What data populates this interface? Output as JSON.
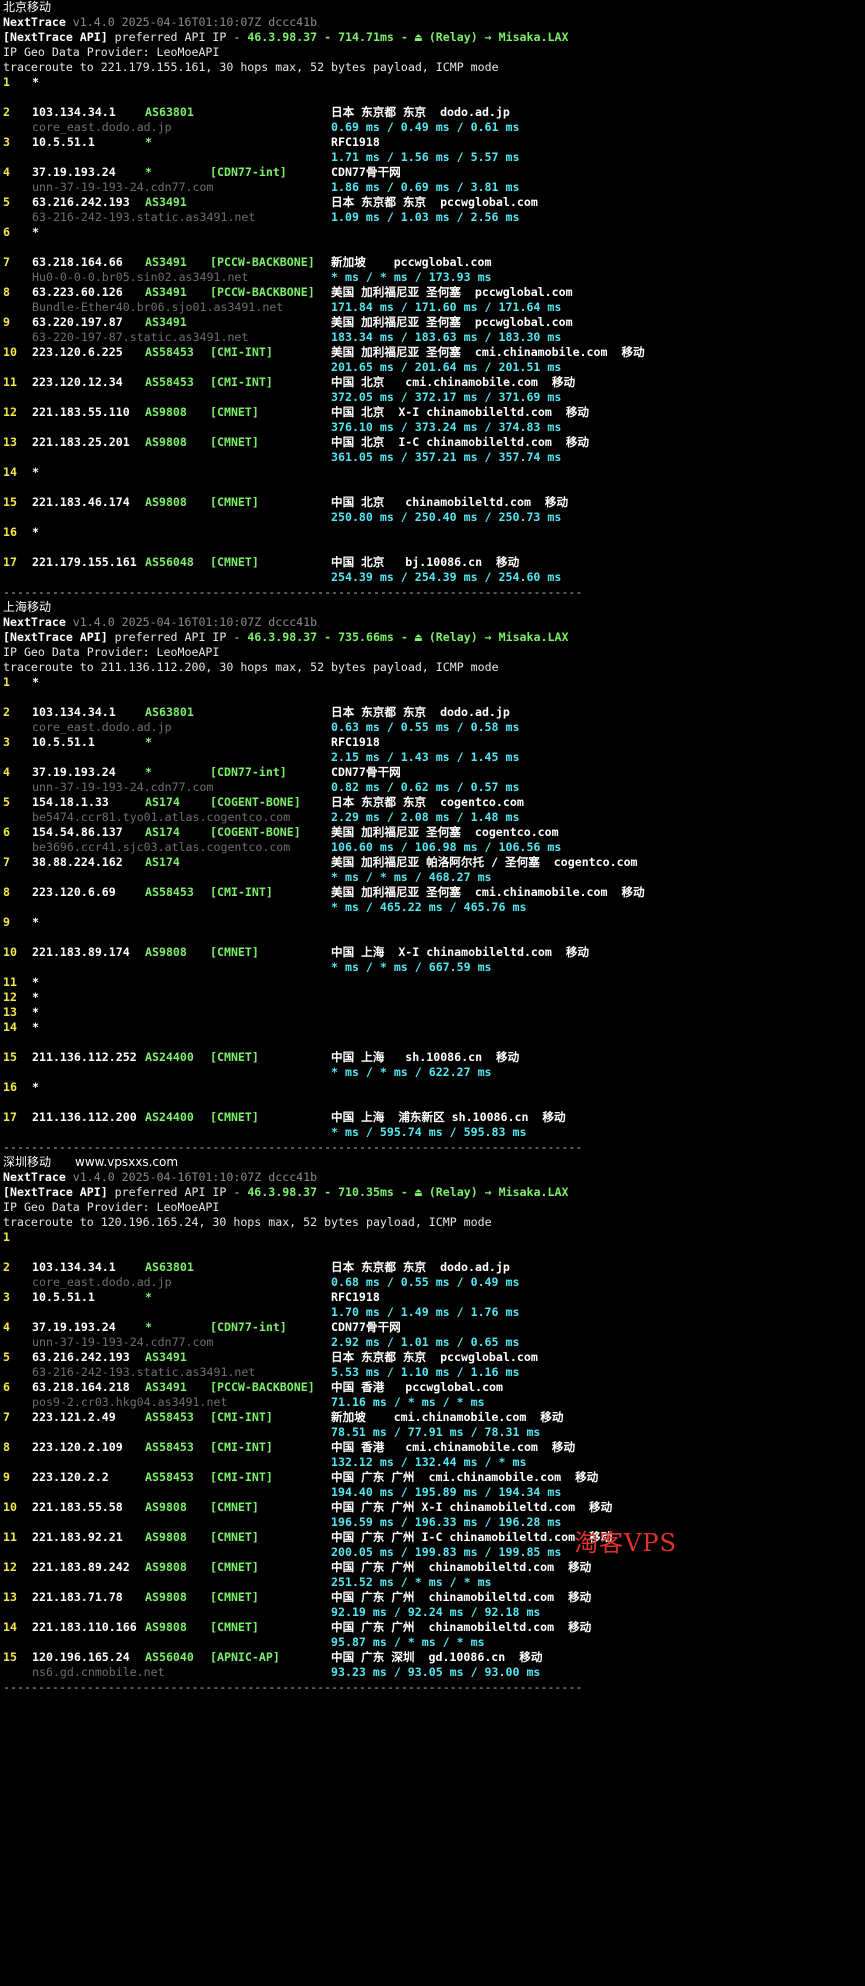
{
  "version_line": "v1.4.0 2025-04-16T01:10:07Z dccc41b",
  "watermark": "淘客VPS",
  "sections": [
    {
      "header": "北京移动",
      "api_label": "[NextTrace API]",
      "api_text": " preferred API IP - ",
      "api_ip": "46.3.98.37",
      "api_rest": " - 714.71ms - ",
      "api_relay": "⏏ (Relay) → Misaka.LAX",
      "geo_provider": "IP Geo Data Provider: LeoMoeAPI",
      "trace_cmd": "traceroute to 221.179.155.161, 30 hops max, 52 bytes payload, ICMP mode",
      "hops": [
        {
          "n": "1",
          "star": true
        },
        {
          "n": "2",
          "ip": "103.134.34.1",
          "asn": "AS63801",
          "tag": "",
          "geo": "日本 东京都 东京  dodo.ad.jp",
          "rdns": "core_east.dodo.ad.jp",
          "rtt": "0.69 ms / 0.49 ms / 0.61 ms"
        },
        {
          "n": "3",
          "ip": "10.5.51.1",
          "asn": "*",
          "tag": "",
          "geo": "RFC1918",
          "rdns": "",
          "rtt": "1.71 ms / 1.56 ms / 5.57 ms"
        },
        {
          "n": "4",
          "ip": "37.19.193.24",
          "asn": "*",
          "tag": "[CDN77-int]",
          "geo": "CDN77骨干网",
          "rdns": "unn-37-19-193-24.cdn77.com",
          "rtt": "1.86 ms / 0.69 ms / 3.81 ms"
        },
        {
          "n": "5",
          "ip": "63.216.242.193",
          "asn": "AS3491",
          "tag": "",
          "geo": "日本 东京都 东京  pccwglobal.com",
          "rdns": "63-216-242-193.static.as3491.net",
          "rtt": "1.09 ms / 1.03 ms / 2.56 ms",
          "rtt_same": true
        },
        {
          "n": "6",
          "star": true
        },
        {
          "n": "7",
          "ip": "63.218.164.66",
          "asn": "AS3491",
          "tag": "[PCCW-BACKBONE]",
          "geo": "新加坡    pccwglobal.com",
          "rdns": "Hu0-0-0-0.br05.sin02.as3491.net",
          "rtt": "* ms / * ms / 173.93 ms"
        },
        {
          "n": "8",
          "ip": "63.223.60.126",
          "asn": "AS3491",
          "tag": "[PCCW-BACKBONE]",
          "geo": "美国 加利福尼亚 圣何塞  pccwglobal.com",
          "rdns": "Bundle-Ether40.br06.sjo01.as3491.net",
          "rtt": "171.84 ms / 171.60 ms / 171.64 ms"
        },
        {
          "n": "9",
          "ip": "63.220.197.87",
          "asn": "AS3491",
          "tag": "",
          "geo": "美国 加利福尼亚 圣何塞  pccwglobal.com",
          "rdns": "63-220-197-87.static.as3491.net",
          "rtt": "183.34 ms / 183.63 ms / 183.30 ms"
        },
        {
          "n": "10",
          "ip": "223.120.6.225",
          "asn": "AS58453",
          "tag": "[CMI-INT]",
          "geo": "美国 加利福尼亚 圣何塞  cmi.chinamobile.com  移动",
          "rdns": "",
          "rtt": "201.65 ms / 201.64 ms / 201.51 ms"
        },
        {
          "n": "11",
          "ip": "223.120.12.34",
          "asn": "AS58453",
          "tag": "[CMI-INT]",
          "geo": "中国 北京   cmi.chinamobile.com  移动",
          "rdns": "",
          "rtt": "372.05 ms / 372.17 ms / 371.69 ms"
        },
        {
          "n": "12",
          "ip": "221.183.55.110",
          "asn": "AS9808",
          "tag": "[CMNET]",
          "geo": "中国 北京  X-I chinamobileltd.com  移动",
          "rdns": "",
          "rtt": "376.10 ms / 373.24 ms / 374.83 ms"
        },
        {
          "n": "13",
          "ip": "221.183.25.201",
          "asn": "AS9808",
          "tag": "[CMNET]",
          "geo": "中国 北京  I-C chinamobileltd.com  移动",
          "rdns": "",
          "rtt": "361.05 ms / 357.21 ms / 357.74 ms"
        },
        {
          "n": "14",
          "star": true
        },
        {
          "n": "15",
          "ip": "221.183.46.174",
          "asn": "AS9808",
          "tag": "[CMNET]",
          "geo": "中国 北京   chinamobileltd.com  移动",
          "rdns": "",
          "rtt": "250.80 ms / 250.40 ms / 250.73 ms"
        },
        {
          "n": "16",
          "star": true
        },
        {
          "n": "17",
          "ip": "221.179.155.161",
          "asn": "AS56048",
          "tag": "[CMNET]",
          "geo": "中国 北京   bj.10086.cn  移动",
          "rdns": "",
          "rtt": "254.39 ms / 254.39 ms / 254.60 ms"
        }
      ]
    },
    {
      "header": "上海移动",
      "api_label": "[NextTrace API]",
      "api_text": " preferred API IP - ",
      "api_ip": "46.3.98.37",
      "api_rest": " - 735.66ms - ",
      "api_relay": "⏏ (Relay) → Misaka.LAX",
      "geo_provider": "IP Geo Data Provider: LeoMoeAPI",
      "trace_cmd": "traceroute to 211.136.112.200, 30 hops max, 52 bytes payload, ICMP mode",
      "hops": [
        {
          "n": "1",
          "star": true
        },
        {
          "n": "2",
          "ip": "103.134.34.1",
          "asn": "AS63801",
          "tag": "",
          "geo": "日本 东京都 东京  dodo.ad.jp",
          "rdns": "core_east.dodo.ad.jp",
          "rtt": "0.63 ms / 0.55 ms / 0.58 ms"
        },
        {
          "n": "3",
          "ip": "10.5.51.1",
          "asn": "*",
          "tag": "",
          "geo": "RFC1918",
          "rdns": "",
          "rtt": "2.15 ms / 1.43 ms / 1.45 ms"
        },
        {
          "n": "4",
          "ip": "37.19.193.24",
          "asn": "*",
          "tag": "[CDN77-int]",
          "geo": "CDN77骨干网",
          "rdns": "unn-37-19-193-24.cdn77.com",
          "rtt": "0.82 ms / 0.62 ms / 0.57 ms"
        },
        {
          "n": "5",
          "ip": "154.18.1.33",
          "asn": "AS174",
          "tag": "[COGENT-BONE]",
          "geo": "日本 东京都 东京  cogentco.com",
          "rdns": "be5474.ccr81.tyo01.atlas.cogentco.com",
          "rtt": "2.29 ms / 2.08 ms / 1.48 ms"
        },
        {
          "n": "6",
          "ip": "154.54.86.137",
          "asn": "AS174",
          "tag": "[COGENT-BONE]",
          "geo": "美国 加利福尼亚 圣何塞  cogentco.com",
          "rdns": "be3696.ccr41.sjc03.atlas.cogentco.com",
          "rtt": "106.60 ms / 106.98 ms / 106.56 ms"
        },
        {
          "n": "7",
          "ip": "38.88.224.162",
          "asn": "AS174",
          "tag": "",
          "geo": "美国 加利福尼亚 帕洛阿尔托 / 圣何塞  cogentco.com",
          "rdns": "",
          "rtt": "* ms / * ms / 468.27 ms"
        },
        {
          "n": "8",
          "ip": "223.120.6.69",
          "asn": "AS58453",
          "tag": "[CMI-INT]",
          "geo": "美国 加利福尼亚 圣何塞  cmi.chinamobile.com  移动",
          "rdns": "",
          "rtt": "* ms / 465.22 ms / 465.76 ms"
        },
        {
          "n": "9",
          "star": true
        },
        {
          "n": "10",
          "ip": "221.183.89.174",
          "asn": "AS9808",
          "tag": "[CMNET]",
          "geo": "中国 上海  X-I chinamobileltd.com  移动",
          "rdns": "",
          "rtt": "* ms / * ms / 667.59 ms"
        },
        {
          "n": "11",
          "star": true,
          "tight": true
        },
        {
          "n": "12",
          "star": true,
          "tight": true
        },
        {
          "n": "13",
          "star": true,
          "tight": true
        },
        {
          "n": "14",
          "star": true
        },
        {
          "n": "15",
          "ip": "211.136.112.252",
          "asn": "AS24400",
          "tag": "[CMNET]",
          "geo": "中国 上海   sh.10086.cn  移动",
          "rdns": "",
          "rtt": "* ms / * ms / 622.27 ms"
        },
        {
          "n": "16",
          "star": true
        },
        {
          "n": "17",
          "ip": "211.136.112.200",
          "asn": "AS24400",
          "tag": "[CMNET]",
          "geo": "中国 上海  浦东新区 sh.10086.cn  移动",
          "rdns": "",
          "rtt": "* ms / 595.74 ms / 595.83 ms"
        }
      ]
    },
    {
      "header": "深圳移动",
      "site": "www.vpsxxs.com",
      "api_label": "[NextTrace API]",
      "api_text": " preferred API IP - ",
      "api_ip": "46.3.98.37",
      "api_rest": " - 710.35ms - ",
      "api_relay": "⏏ (Relay) → Misaka.LAX",
      "geo_provider": "IP Geo Data Provider: LeoMoeAPI",
      "trace_cmd": "traceroute to 120.196.165.24, 30 hops max, 52 bytes payload, ICMP mode",
      "hops": [
        {
          "n": "1",
          "star": true,
          "nostar": true
        },
        {
          "n": "2",
          "ip": "103.134.34.1",
          "asn": "AS63801",
          "tag": "",
          "geo": "日本 东京都 东京  dodo.ad.jp",
          "rdns": "core_east.dodo.ad.jp",
          "rtt": "0.68 ms / 0.55 ms / 0.49 ms"
        },
        {
          "n": "3",
          "ip": "10.5.51.1",
          "asn": "*",
          "tag": "",
          "geo": "RFC1918",
          "rdns": "",
          "rtt": "1.70 ms / 1.49 ms / 1.76 ms"
        },
        {
          "n": "4",
          "ip": "37.19.193.24",
          "asn": "*",
          "tag": "[CDN77-int]",
          "geo": "CDN77骨干网",
          "rdns": "unn-37-19-193-24.cdn77.com",
          "rtt": "2.92 ms / 1.01 ms / 0.65 ms"
        },
        {
          "n": "5",
          "ip": "63.216.242.193",
          "asn": "AS3491",
          "tag": "",
          "geo": "日本 东京都 东京  pccwglobal.com",
          "rdns": "63-216-242-193.static.as3491.net",
          "rtt": "5.53 ms / 1.10 ms / 1.16 ms",
          "rtt_same": true
        },
        {
          "n": "6",
          "ip": "63.218.164.218",
          "asn": "AS3491",
          "tag": "[PCCW-BACKBONE]",
          "geo": "中国 香港   pccwglobal.com",
          "rdns": "pos9-2.cr03.hkg04.as3491.net",
          "rtt": "71.16 ms / * ms / * ms",
          "rtt_same": true
        },
        {
          "n": "7",
          "ip": "223.121.2.49",
          "asn": "AS58453",
          "tag": "[CMI-INT]",
          "geo": "新加坡    cmi.chinamobile.com  移动",
          "rdns": "",
          "rtt": "78.51 ms / 77.91 ms / 78.31 ms"
        },
        {
          "n": "8",
          "ip": "223.120.2.109",
          "asn": "AS58453",
          "tag": "[CMI-INT]",
          "geo": "中国 香港   cmi.chinamobile.com  移动",
          "rdns": "",
          "rtt": "132.12 ms / 132.44 ms / * ms"
        },
        {
          "n": "9",
          "ip": "223.120.2.2",
          "asn": "AS58453",
          "tag": "[CMI-INT]",
          "geo": "中国 广东 广州  cmi.chinamobile.com  移动",
          "rdns": "",
          "rtt": "194.40 ms / 195.89 ms / 194.34 ms"
        },
        {
          "n": "10",
          "ip": "221.183.55.58",
          "asn": "AS9808",
          "tag": "[CMNET]",
          "geo": "中国 广东 广州 X-I chinamobileltd.com  移动",
          "rdns": "",
          "rtt": "196.59 ms / 196.33 ms / 196.28 ms"
        },
        {
          "n": "11",
          "ip": "221.183.92.21",
          "asn": "AS9808",
          "tag": "[CMNET]",
          "geo": "中国 广东 广州 I-C chinamobileltd.com  移动",
          "rdns": "",
          "rtt": "200.05 ms / 199.83 ms / 199.85 ms"
        },
        {
          "n": "12",
          "ip": "221.183.89.242",
          "asn": "AS9808",
          "tag": "[CMNET]",
          "geo": "中国 广东 广州  chinamobileltd.com  移动",
          "rdns": "",
          "rtt": "251.52 ms / * ms / * ms"
        },
        {
          "n": "13",
          "ip": "221.183.71.78",
          "asn": "AS9808",
          "tag": "[CMNET]",
          "geo": "中国 广东 广州  chinamobileltd.com  移动",
          "rdns": "",
          "rtt": "92.19 ms / 92.24 ms / 92.18 ms"
        },
        {
          "n": "14",
          "ip": "221.183.110.166",
          "asn": "AS9808",
          "tag": "[CMNET]",
          "geo": "中国 广东 广州  chinamobileltd.com  移动",
          "rdns": "",
          "rtt": "95.87 ms / * ms / * ms"
        },
        {
          "n": "15",
          "ip": "120.196.165.24",
          "asn": "AS56040",
          "tag": "[APNIC-AP]",
          "geo": "中国 广东 深圳  gd.10086.cn  移动",
          "rdns": "ns6.gd.cnmobile.net",
          "rtt": "93.23 ms / 93.05 ms / 93.00 ms"
        }
      ]
    }
  ]
}
